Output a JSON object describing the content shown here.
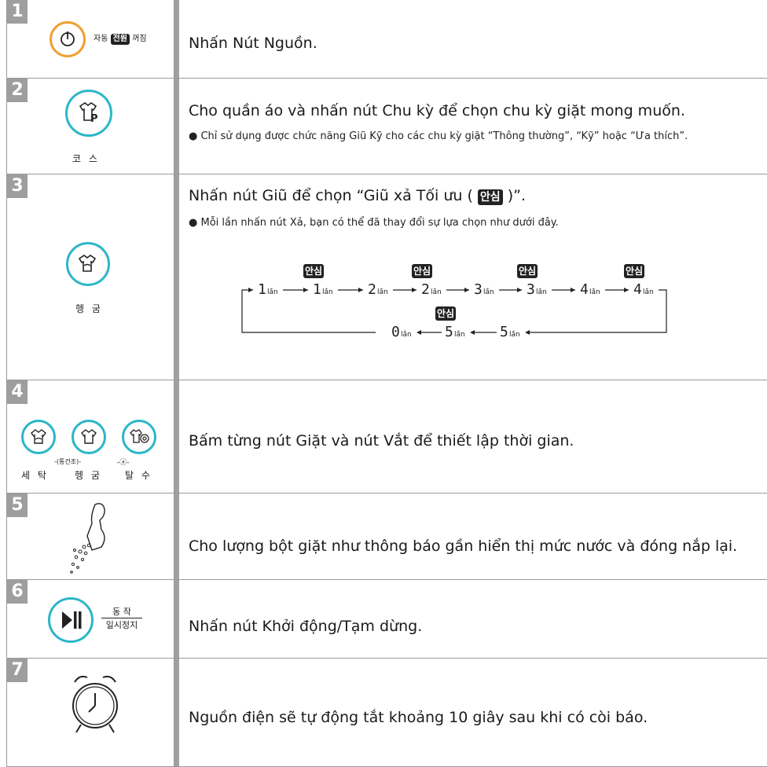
{
  "steps": [
    {
      "number": "1",
      "text": "Nhấn Nút Nguồn.",
      "button_label_1": "자동",
      "button_label_badge": "전원",
      "button_label_2": "꺼짐"
    },
    {
      "number": "2",
      "text": "Cho quần áo và nhấn nút Chu kỳ để chọn chu kỳ giặt mong muốn.",
      "bullet": "● Chỉ sử dụng được chức năng Giũ Kỹ cho các chu kỳ giặt “Thông thường”, “Kỹ” hoặc “Ưa thích”.",
      "button_label": "코 스"
    },
    {
      "number": "3",
      "text_before": "Nhấn nút Giũ để chọn “Giũ xả Tối ưu ( ",
      "text_badge": "안심",
      "text_after": " )”.",
      "bullet": "● Mỗi lần nhấn nút Xả, bạn có thể đã thay đổi sự lựa chọn như dưới đây.",
      "button_label": "헹 굼"
    },
    {
      "number": "4",
      "text": "Bấm từng nút Giặt và nút Vắt để thiết lập thời gian.",
      "labels": [
        "세 탁",
        "헹 굼",
        "탈 수"
      ],
      "sublabel": "통건조"
    },
    {
      "number": "5",
      "text": "Cho lượng bột giặt như thông báo gần hiển thị mức nước và đóng nắp lại."
    },
    {
      "number": "6",
      "text": "Nhấn nút Khởi động/Tạm dừng.",
      "label_top": "동 작",
      "label_bottom": "일시정지"
    },
    {
      "number": "7",
      "text": "Nguồn điện sẽ tự động tắt khoảng 10 giây sau khi có còi báo."
    }
  ],
  "sequence": {
    "top": [
      "1",
      "1",
      "2",
      "2",
      "3",
      "3",
      "4",
      "4"
    ],
    "bottom": [
      "0",
      "5",
      "5"
    ],
    "unit": "lần",
    "badge": "안심"
  },
  "colors": {
    "power_ring": "#f0a030",
    "cyan_ring": "#2bb6c8",
    "gray_block": "#9e9e9e"
  }
}
